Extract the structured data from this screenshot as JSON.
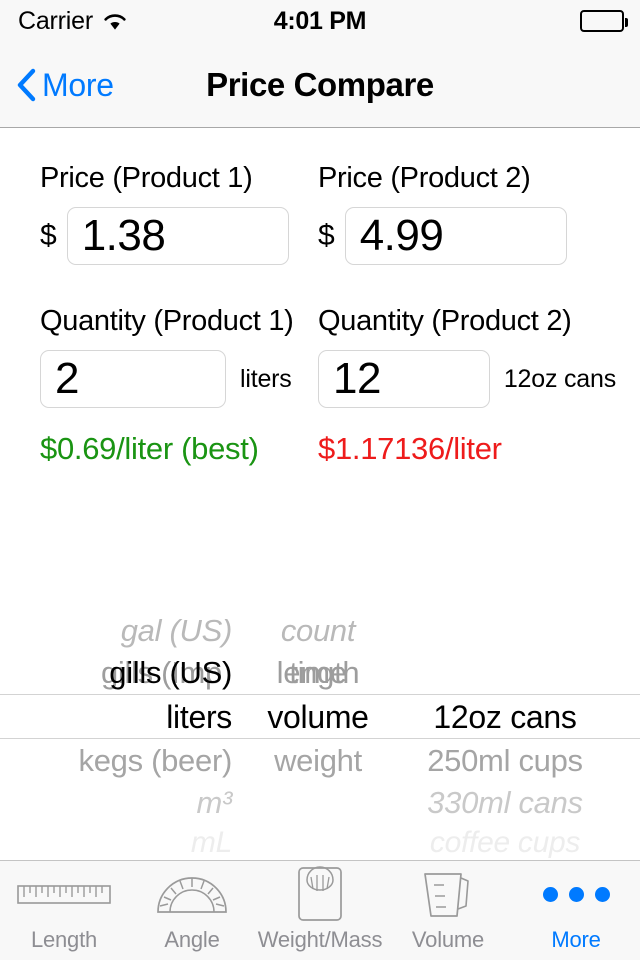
{
  "status_bar": {
    "carrier": "Carrier",
    "wifi_icon": "wifi-icon",
    "time": "4:01 PM",
    "battery_icon": "battery-full-icon"
  },
  "nav_bar": {
    "back_icon": "chevron-left-icon",
    "back_label": "More",
    "title": "Price Compare"
  },
  "form": {
    "product1": {
      "price_label": "Price (Product 1)",
      "currency_symbol": "$",
      "price_value": "1.38",
      "quantity_label": "Quantity (Product 1)",
      "quantity_value": "2",
      "quantity_unit": "liters",
      "result": "$0.69/liter (best)",
      "result_color": "#1a9413"
    },
    "product2": {
      "price_label": "Price (Product 2)",
      "currency_symbol": "$",
      "price_value": "4.99",
      "quantity_label": "Quantity (Product 2)",
      "quantity_value": "12",
      "quantity_unit": "12oz cans",
      "result": "$1.17136/liter",
      "result_color": "#ee1b1b"
    }
  },
  "picker": {
    "column1": {
      "name": "unit-product1",
      "selected": "liters",
      "rows": [
        "",
        "",
        "gal (US)",
        "gills (Imp)",
        "gills (US)",
        "liters",
        "kegs (beer)",
        "m³",
        "mL"
      ]
    },
    "column2": {
      "name": "measure-category",
      "selected": "volume",
      "rows": [
        "",
        "",
        "count",
        "length",
        "time",
        "volume",
        "weight",
        "",
        ""
      ]
    },
    "column3": {
      "name": "unit-product2",
      "selected": "12oz cans",
      "rows": [
        "",
        "",
        "",
        "",
        "",
        "12oz cans",
        "250ml cups",
        "330ml cans",
        "coffee cups"
      ]
    }
  },
  "tab_bar": {
    "tabs": [
      {
        "label": "Length",
        "icon": "ruler-icon",
        "active": false
      },
      {
        "label": "Angle",
        "icon": "protractor-icon",
        "active": false
      },
      {
        "label": "Weight/Mass",
        "icon": "scale-icon",
        "active": false
      },
      {
        "label": "Volume",
        "icon": "measuring-cup-icon",
        "active": false
      },
      {
        "label": "More",
        "icon": "ellipsis-icon",
        "active": true
      }
    ]
  },
  "colors": {
    "accent_blue": "#007aff",
    "best_green": "#1a9413",
    "worse_red": "#ee1b1b",
    "bar_background": "#f8f8f8",
    "inactive_gray": "#8e8e93"
  }
}
